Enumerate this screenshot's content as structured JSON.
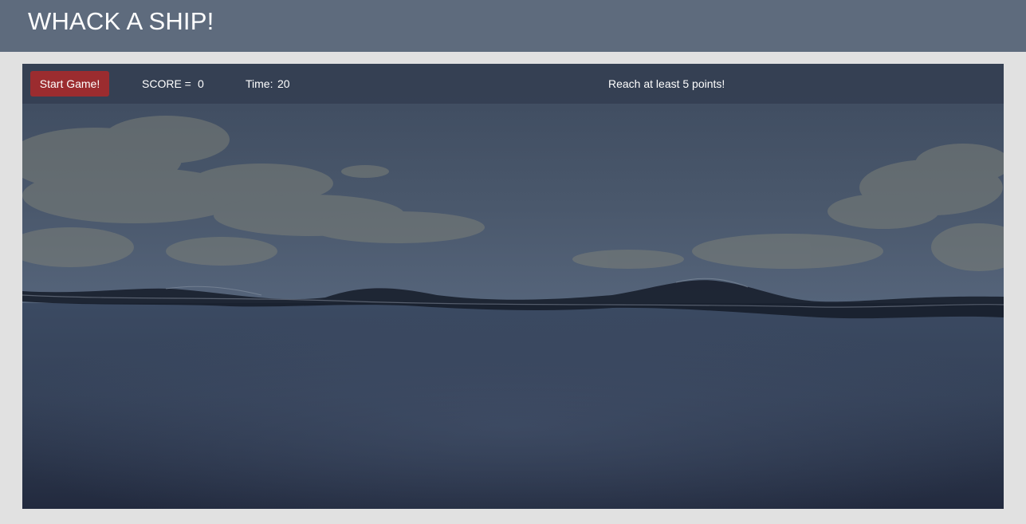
{
  "header": {
    "title": "WHACK A SHIP!"
  },
  "controls": {
    "start_label": "Start Game!",
    "score_label": "SCORE =",
    "score_value": "0",
    "time_label": "Time:",
    "time_value": "20",
    "goal_text": "Reach at least 5 points!"
  },
  "colors": {
    "header_bg": "#5e6b7d",
    "page_bg": "#e1e1e1",
    "start_button": "#9b2c2f",
    "hud_bar": "#343f52",
    "sea": "#2e3a4e"
  },
  "scene": {
    "background": "ocean-horizon-image"
  }
}
